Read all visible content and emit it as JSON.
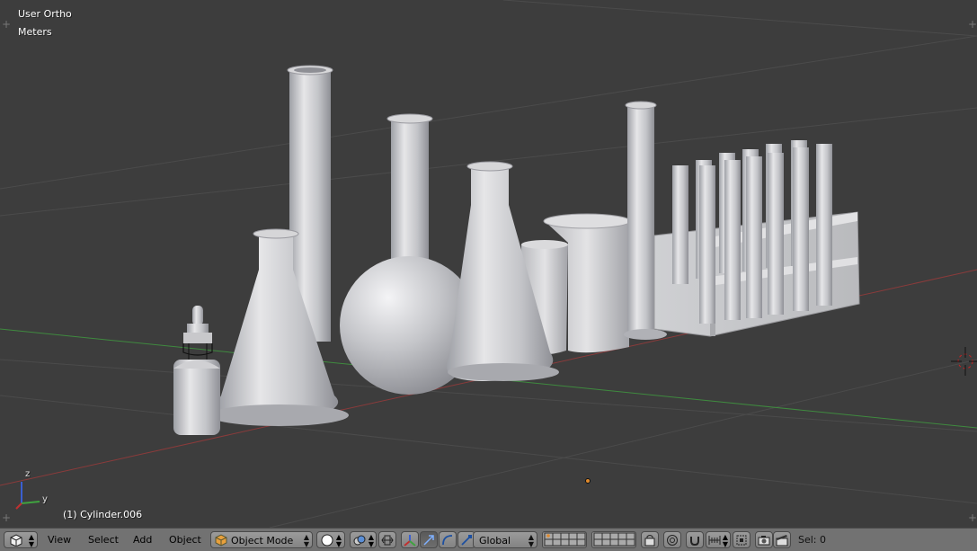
{
  "viewport": {
    "view_name": "User Ortho",
    "units": "Meters",
    "object_info": "(1) Cylinder.006",
    "axis_labels": {
      "z": "z",
      "y": "y"
    }
  },
  "header": {
    "menu": {
      "view": "View",
      "select": "Select",
      "add": "Add",
      "object": "Object"
    },
    "mode": "Object Mode",
    "orientation": "Global",
    "selection_count": "Sel: 0"
  },
  "icons": {
    "editor_type": "3d-view-icon",
    "mode": "object-cube-icon",
    "shading": "solid-sphere-icon",
    "pivot": "pivot-point-icon",
    "manipulator": "manipulator-axes-icon",
    "translate": "translate-arrow-icon",
    "rotate": "rotate-arc-icon",
    "scale": "scale-icon",
    "layers": "layer-grid-icon",
    "snap": "magnet-icon",
    "render": "camera-icon"
  },
  "colors": {
    "viewport_bg": "#3d3d3d",
    "grid_line": "#4b4b4b",
    "x_axis": "#8a3b3b",
    "y_axis": "#3f8a3f",
    "header_bg": "#727272",
    "glass": "#c9c9cc"
  }
}
